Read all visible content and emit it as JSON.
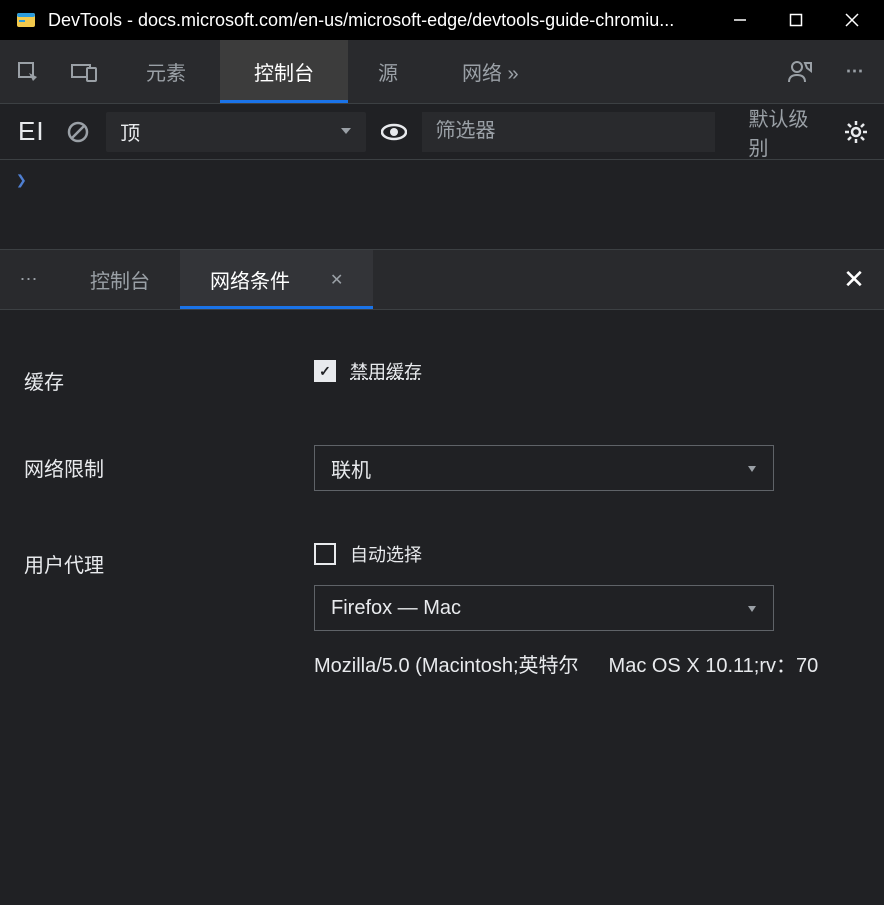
{
  "titlebar": {
    "title": "DevTools - docs.microsoft.com/en-us/microsoft-edge/devtools-guide-chromiu..."
  },
  "mainTabs": {
    "elements": "元素",
    "console": "控制台",
    "sources": "源",
    "network": "网络 »"
  },
  "consoleToolbar": {
    "sidebarLabel": "EI",
    "contextSelected": "顶",
    "filterPlaceholder": "筛选器",
    "levelLabel": "默认级别"
  },
  "console": {
    "prompt": "❯"
  },
  "drawerTabs": {
    "console": "控制台",
    "networkConditions": "网络条件"
  },
  "networkConditions": {
    "cacheLabel": "缓存",
    "disableCacheLabel": "禁用缓存",
    "throttlingLabel": "网络限制",
    "throttlingValue": "联机",
    "userAgentLabel": "用户代理",
    "autoSelectLabel": "自动选择",
    "uaSelected": "Firefox — Mac",
    "uaStringPart1": "Mozilla/5.0 (Macintosh;英特尔",
    "uaStringPart2": "Mac OS X 10.11;rv：70"
  }
}
